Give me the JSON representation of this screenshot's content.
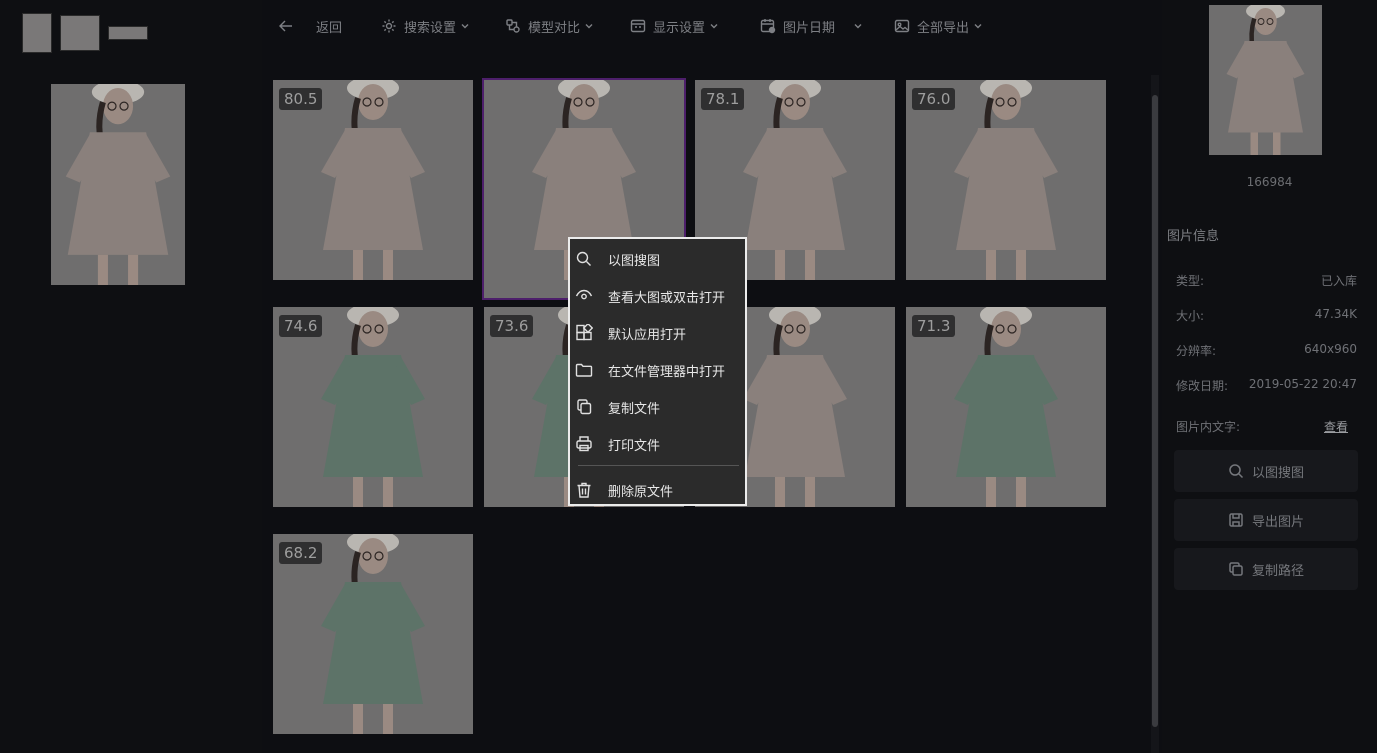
{
  "toolbar": {
    "back_label": "返回",
    "search_settings_label": "搜索设置",
    "model_compare_label": "模型对比",
    "display_settings_label": "显示设置",
    "image_date_label": "图片日期",
    "export_all_label": "全部导出"
  },
  "results": [
    {
      "score": "80.5",
      "dress": "pink"
    },
    {
      "score": "",
      "dress": "pink"
    },
    {
      "score": "78.1",
      "dress": "pink"
    },
    {
      "score": "76.0",
      "dress": "pink"
    },
    {
      "score": "74.6",
      "dress": "green"
    },
    {
      "score": "73.6",
      "dress": "green"
    },
    {
      "score": "",
      "dress": "pink"
    },
    {
      "score": "71.3",
      "dress": "green"
    },
    {
      "score": "68.2",
      "dress": "green"
    }
  ],
  "context_menu": {
    "items": [
      {
        "label": "以图搜图",
        "icon": "search-icon"
      },
      {
        "label": "查看大图或双击打开",
        "icon": "eye-icon"
      },
      {
        "label": "默认应用打开",
        "icon": "apps-icon"
      },
      {
        "label": "在文件管理器中打开",
        "icon": "folder-icon"
      },
      {
        "label": "复制文件",
        "icon": "copy-icon"
      },
      {
        "label": "打印文件",
        "icon": "printer-icon"
      },
      {
        "label": "删除原文件",
        "icon": "trash-icon"
      }
    ]
  },
  "detail": {
    "id": "166984",
    "section_title": "图片信息",
    "type_label": "类型:",
    "type_value": "已入库",
    "size_label": "大小:",
    "size_value": "47.34K",
    "resolution_label": "分辨率:",
    "resolution_value": "640x960",
    "modified_label": "修改日期:",
    "modified_value": "2019-05-22 20:47",
    "text_label": "图片内文字:",
    "text_link": "查看",
    "btn_search": "以图搜图",
    "btn_export": "导出图片",
    "btn_copy_path": "复制路径"
  },
  "colors": {
    "pink": "#8a807c",
    "green": "#5d7368",
    "skin": "#9a8a82",
    "hair": "#2b2422",
    "hat": "#b9b6b1"
  }
}
